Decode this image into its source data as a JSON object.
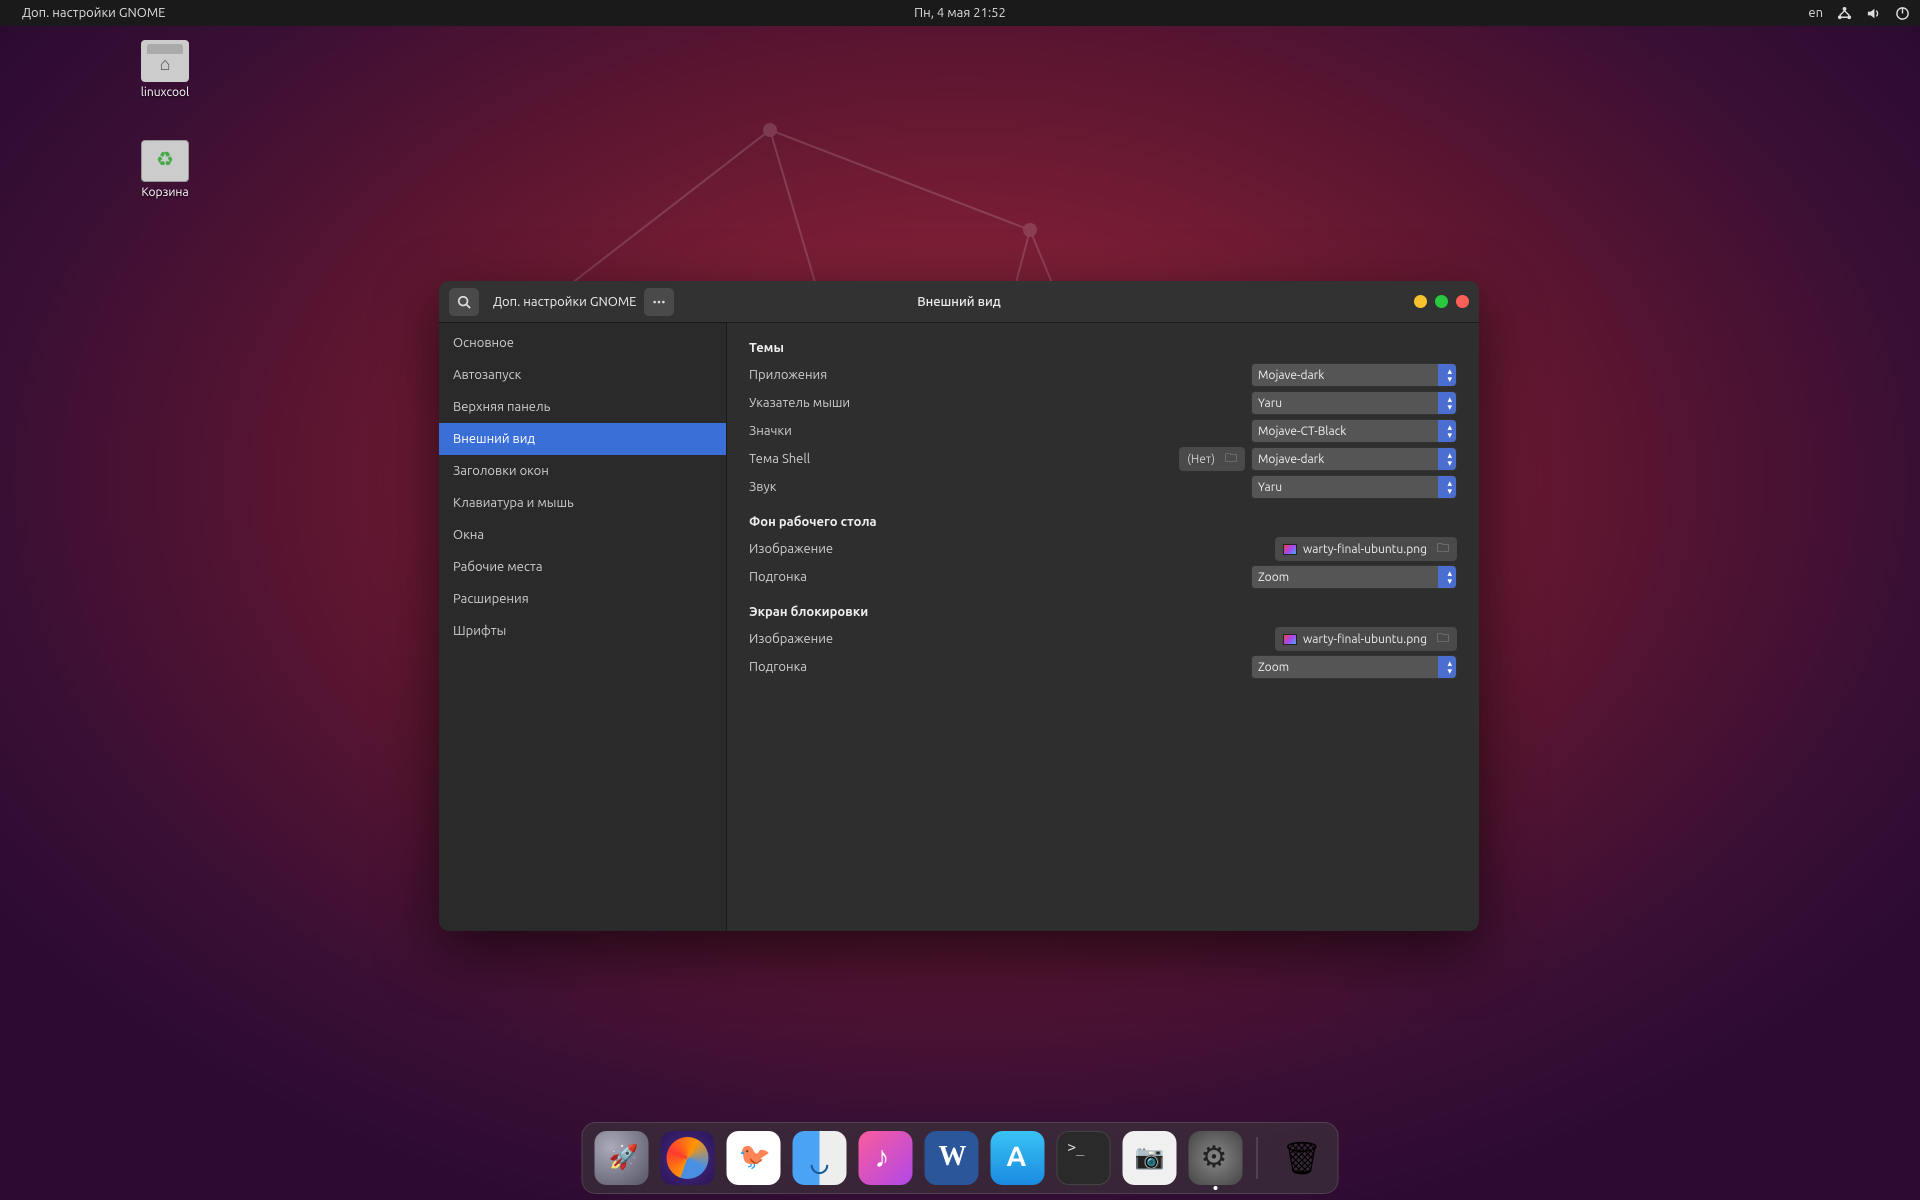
{
  "topbar": {
    "app_title": "Доп. настройки GNOME",
    "datetime": "Пн, 4 мая  21:52",
    "lang": "en"
  },
  "desktop_icons": {
    "home": "linuxcool",
    "trash": "Корзина"
  },
  "window": {
    "titlebar_title": "Доп. настройки GNOME",
    "header_title": "Внешний вид"
  },
  "sidebar": {
    "items": [
      "Основное",
      "Автозапуск",
      "Верхняя панель",
      "Внешний вид",
      "Заголовки окон",
      "Клавиатура и мышь",
      "Окна",
      "Рабочие места",
      "Расширения",
      "Шрифты"
    ],
    "active_index": 3
  },
  "content": {
    "themes": {
      "title": "Темы",
      "rows": {
        "applications": {
          "label": "Приложения",
          "value": "Mojave-dark"
        },
        "cursor": {
          "label": "Указатель мыши",
          "value": "Yaru"
        },
        "icons": {
          "label": "Значки",
          "value": "Mojave-CT-Black"
        },
        "shell": {
          "label": "Тема Shell",
          "none_label": "(Нет)",
          "value": "Mojave-dark"
        },
        "sound": {
          "label": "Звук",
          "value": "Yaru"
        }
      }
    },
    "background": {
      "title": "Фон рабочего стола",
      "image_label": "Изображение",
      "image_file": "warty-final-ubuntu.png",
      "fit_label": "Подгонка",
      "fit_value": "Zoom"
    },
    "lockscreen": {
      "title": "Экран блокировки",
      "image_label": "Изображение",
      "image_file": "warty-final-ubuntu.png",
      "fit_label": "Подгонка",
      "fit_value": "Zoom"
    }
  },
  "dock": {
    "items": [
      {
        "name": "launchpad"
      },
      {
        "name": "firefox"
      },
      {
        "name": "mail"
      },
      {
        "name": "finder"
      },
      {
        "name": "music"
      },
      {
        "name": "word"
      },
      {
        "name": "app-store"
      },
      {
        "name": "terminal"
      },
      {
        "name": "screenshot"
      },
      {
        "name": "settings",
        "running": true
      }
    ]
  }
}
